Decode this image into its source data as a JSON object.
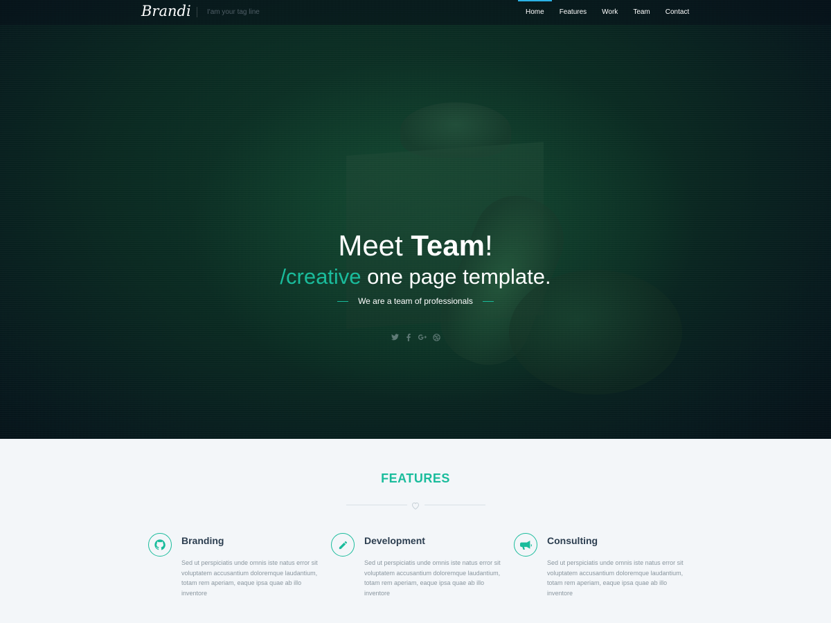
{
  "colors": {
    "accent": "#1abc9c",
    "nav_active": "#2bb3e6",
    "heading_dark": "#2c3e50"
  },
  "nav": {
    "logo": "Brandi",
    "tagline": "I'am your tag line",
    "links": [
      "Home",
      "Features",
      "Work",
      "Team",
      "Contact"
    ],
    "active": "Home"
  },
  "hero": {
    "title_regular": "Meet ",
    "title_bold": "Team",
    "title_end": "!",
    "subtitle_accent": "/creative",
    "subtitle_rest": " one page template.",
    "tagline": "We are a team of professionals",
    "socials": [
      "twitter-icon",
      "facebook-icon",
      "google-plus-icon",
      "dribbble-icon"
    ]
  },
  "features": {
    "title": "FEATURES",
    "divider_icon": "heart-icon",
    "items": [
      {
        "icon": "github-icon",
        "title": "Branding",
        "text": "Sed ut perspiciatis unde omnis iste natus error sit voluptatem accusantium doloremque laudantium, totam rem aperiam, eaque ipsa quae ab illo inventore"
      },
      {
        "icon": "pencil-icon",
        "title": "Development",
        "text": "Sed ut perspiciatis unde omnis iste natus error sit voluptatem accusantium doloremque laudantium, totam rem aperiam, eaque ipsa quae ab illo inventore"
      },
      {
        "icon": "megaphone-icon",
        "title": "Consulting",
        "text": "Sed ut perspiciatis unde omnis iste natus error sit voluptatem accusantium doloremque laudantium, totam rem aperiam, eaque ipsa quae ab illo inventore"
      }
    ]
  }
}
